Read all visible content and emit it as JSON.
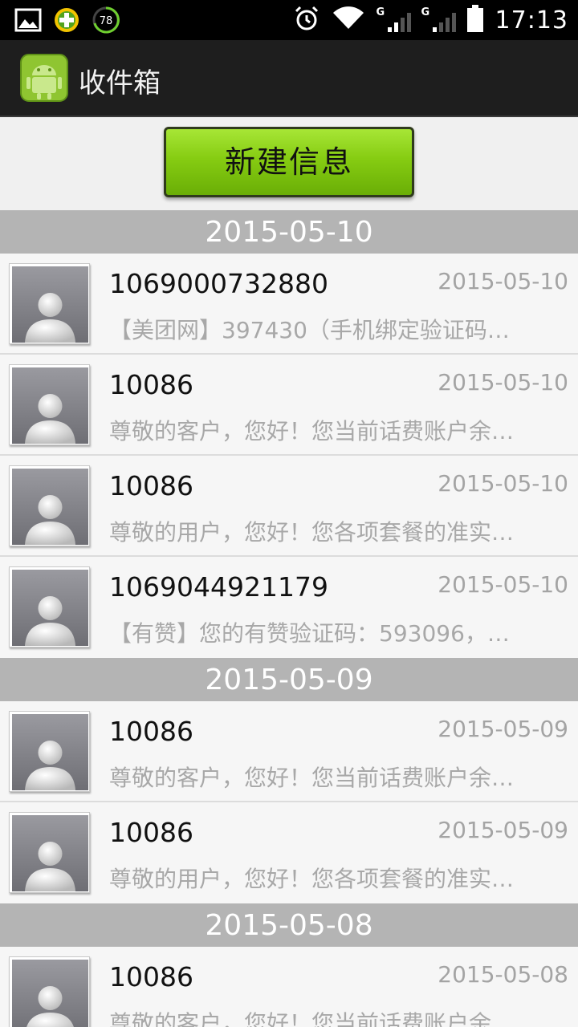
{
  "status_bar": {
    "battery_level": "78",
    "time": "17:13",
    "signal_1_label": "G",
    "signal_2_label": "G"
  },
  "action_bar": {
    "title": "收件箱"
  },
  "new_message_button": {
    "label": "新建信息"
  },
  "groups": [
    {
      "date": "2015-05-10",
      "messages": [
        {
          "sender": "1069000732880",
          "date": "2015-05-10",
          "preview": "【美团网】397430（手机绑定验证码…"
        },
        {
          "sender": "10086",
          "date": "2015-05-10",
          "preview": "尊敬的客户，您好！您当前话费账户余…"
        },
        {
          "sender": "10086",
          "date": "2015-05-10",
          "preview": "尊敬的用户，您好！您各项套餐的准实…"
        },
        {
          "sender": "1069044921179",
          "date": "2015-05-10",
          "preview": "【有赞】您的有赞验证码：593096，…"
        }
      ]
    },
    {
      "date": "2015-05-09",
      "messages": [
        {
          "sender": "10086",
          "date": "2015-05-09",
          "preview": "尊敬的客户，您好！您当前话费账户余…"
        },
        {
          "sender": "10086",
          "date": "2015-05-09",
          "preview": "尊敬的用户，您好！您各项套餐的准实…"
        }
      ]
    },
    {
      "date": "2015-05-08",
      "messages": [
        {
          "sender": "10086",
          "date": "2015-05-08",
          "preview": "尊敬的客户，您好！您当前话费账户余…"
        }
      ]
    }
  ]
}
